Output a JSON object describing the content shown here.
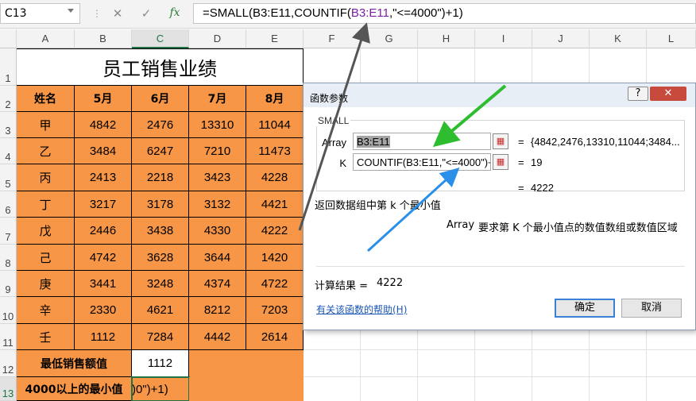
{
  "formula_bar": {
    "name_box": "C13",
    "cancel_icon": "✕",
    "enter_icon": "✓",
    "fx_label": "fx",
    "formula_parts": [
      "=SMALL(B3:E11,COUNTIF(",
      "B3:E11",
      ",\"<=4000\")+1)"
    ]
  },
  "columns": [
    "A",
    "B",
    "C",
    "D",
    "E",
    "F",
    "G",
    "H",
    "I",
    "J",
    "K",
    "L"
  ],
  "active_column": "C",
  "rows": [
    "1",
    "2",
    "3",
    "4",
    "5",
    "6",
    "7",
    "8",
    "9",
    "10",
    "11",
    "12",
    "13"
  ],
  "active_row": "13",
  "sheet": {
    "title": "员工销售业绩",
    "headers": [
      "姓名",
      "5月",
      "6月",
      "7月",
      "8月"
    ],
    "data": [
      [
        "甲",
        "4842",
        "2476",
        "13310",
        "11044"
      ],
      [
        "乙",
        "3484",
        "6247",
        "7210",
        "11473"
      ],
      [
        "丙",
        "2413",
        "2218",
        "3423",
        "4228"
      ],
      [
        "丁",
        "3217",
        "3178",
        "3132",
        "4421"
      ],
      [
        "戊",
        "2446",
        "3438",
        "4330",
        "4222"
      ],
      [
        "己",
        "4742",
        "3628",
        "3644",
        "1420"
      ],
      [
        "庚",
        "3441",
        "3248",
        "4374",
        "4722"
      ],
      [
        "辛",
        "2330",
        "4621",
        "8212",
        "7203"
      ],
      [
        "壬",
        "1112",
        "7284",
        "4442",
        "2614"
      ]
    ],
    "min_label": "最低销售额值",
    "min_value": "1112",
    "min_above_label": "4000以上的最小值",
    "editing_text": ")0\")+1)"
  },
  "dialog": {
    "title": "函数参数",
    "help_button": "?",
    "close_button": "✕",
    "function_name": "SMALL",
    "arg1_label": "Array",
    "arg1_value": "B3:E11",
    "arg1_result": "{4842,2476,13310,11044;3484...",
    "arg2_label": "K",
    "arg2_value": "COUNTIF(B3:E11,\"<=4000\")+",
    "arg2_result": "19",
    "equals": "=",
    "formula_result_inline": "4222",
    "description": "返回数据组中第 k 个最小值",
    "arg_help_name": "Array",
    "arg_help_text": "要求第 K 个最小值点的数值数组或数值区域",
    "result_label": "计算结果 =",
    "result_value": "4222",
    "help_link": "有关该函数的帮助(H)",
    "ok_button": "确定",
    "cancel_button": "取消"
  },
  "colors": {
    "table_fill": "#f79646",
    "selection": "#217346",
    "arrow_gray": "#555555",
    "arrow_green": "#2ebd2e",
    "arrow_blue": "#2a8fe8"
  },
  "icons": [
    "dropdown-arrow-icon",
    "cancel-icon",
    "enter-icon",
    "fx-icon",
    "range-collapse-icon",
    "help-icon",
    "close-icon"
  ]
}
